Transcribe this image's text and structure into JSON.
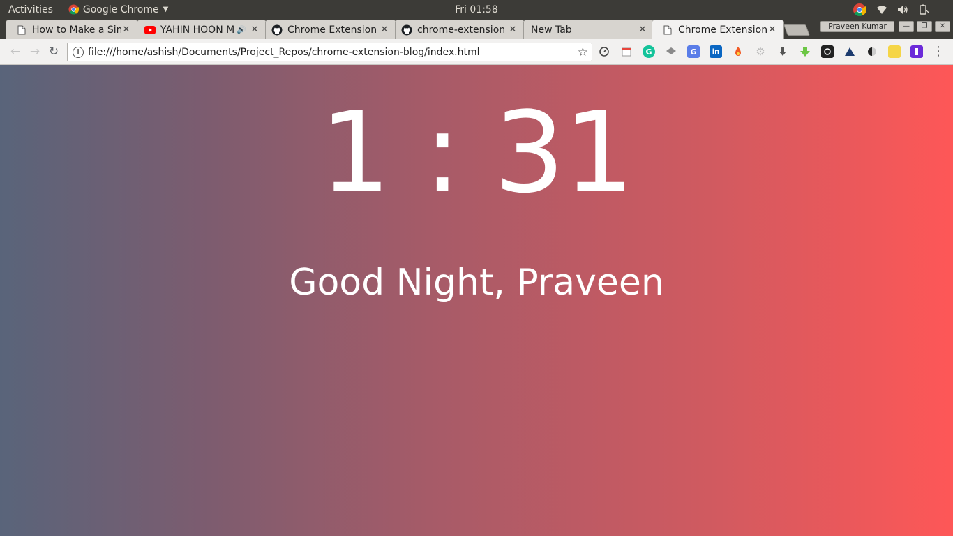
{
  "system_bar": {
    "activities": "Activities",
    "app_name": "Google Chrome",
    "clock": "Fri 01:58"
  },
  "tabs": [
    {
      "title": "How to Make a Sim",
      "favicon": "document-icon",
      "active": false
    },
    {
      "title": "YAHIN HOON M",
      "favicon": "youtube-icon",
      "audio": true,
      "active": false
    },
    {
      "title": "Chrome Extension",
      "favicon": "github-icon",
      "active": false
    },
    {
      "title": "chrome-extension",
      "favicon": "github-icon",
      "active": false
    },
    {
      "title": "New Tab",
      "favicon": "none",
      "active": false
    },
    {
      "title": "Chrome Extension",
      "favicon": "document-icon",
      "active": true
    }
  ],
  "profile_name": "Praveen Kumar",
  "toolbar": {
    "url": "file:///home/ashish/Documents/Project_Repos/chrome-extension-blog/index.html",
    "extensions": [
      "speed-dial-icon",
      "calendar-icon",
      "grammarly-icon",
      "layers-icon",
      "google-translate-icon",
      "linkedin-icon",
      "fire-icon",
      "gear-extension-icon",
      "download-arrow-icon",
      "green-download-icon",
      "dark-camera-icon",
      "triangle-icon",
      "half-circle-icon",
      "sticky-note-icon",
      "purple-bookmark-icon"
    ]
  },
  "content": {
    "time": "1 : 31",
    "greeting": "Good Night, Praveen"
  },
  "colors": {
    "gradient_start": "#59647a",
    "gradient_end": "#fe5757",
    "text": "#ffffff"
  }
}
